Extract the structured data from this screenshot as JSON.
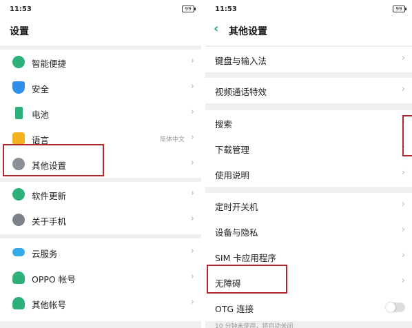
{
  "left": {
    "status_time": "11:53",
    "battery": "99",
    "title": "设置",
    "groups": [
      {
        "items": [
          {
            "label": "智能便捷",
            "icon": "smart-assist-icon",
            "color": "#2db07a"
          },
          {
            "label": "安全",
            "icon": "shield-icon",
            "color": "#2f8ee8"
          },
          {
            "label": "电池",
            "icon": "battery-icon",
            "color": "#2db07a"
          },
          {
            "label": "语言",
            "icon": "language-icon",
            "color": "#f5b21f",
            "value": "简体中文"
          },
          {
            "label": "其他设置",
            "icon": "gear-icon",
            "color": "#8a8f98"
          }
        ]
      },
      {
        "items": [
          {
            "label": "软件更新",
            "icon": "update-icon",
            "color": "#2db07a"
          },
          {
            "label": "关于手机",
            "icon": "info-icon",
            "color": "#7d828a"
          }
        ]
      },
      {
        "items": [
          {
            "label": "云服务",
            "icon": "cloud-icon",
            "color": "#36a9e8"
          },
          {
            "label": "OPPO 帐号",
            "icon": "account-icon",
            "color": "#2db07a"
          },
          {
            "label": "其他帐号",
            "icon": "person-icon",
            "color": "#2db07a"
          }
        ]
      }
    ]
  },
  "right": {
    "status_time": "11:53",
    "battery": "99",
    "title": "其他设置",
    "groups": [
      {
        "items": [
          {
            "label": "键盘与输入法"
          }
        ]
      },
      {
        "items": [
          {
            "label": "视频通话特效"
          }
        ]
      },
      {
        "items": [
          {
            "label": "搜索"
          },
          {
            "label": "下载管理"
          },
          {
            "label": "使用说明"
          }
        ]
      },
      {
        "items": [
          {
            "label": "定时开关机"
          },
          {
            "label": "设备与隐私"
          },
          {
            "label": "SIM 卡应用程序"
          },
          {
            "label": "无障碍"
          },
          {
            "label": "OTG 连接",
            "toggle": true
          }
        ]
      }
    ],
    "footer_note": "10 分钟未使用，将自动关闭"
  },
  "colors": {
    "accent": "#1aa86a",
    "highlight": "#b0282d"
  }
}
